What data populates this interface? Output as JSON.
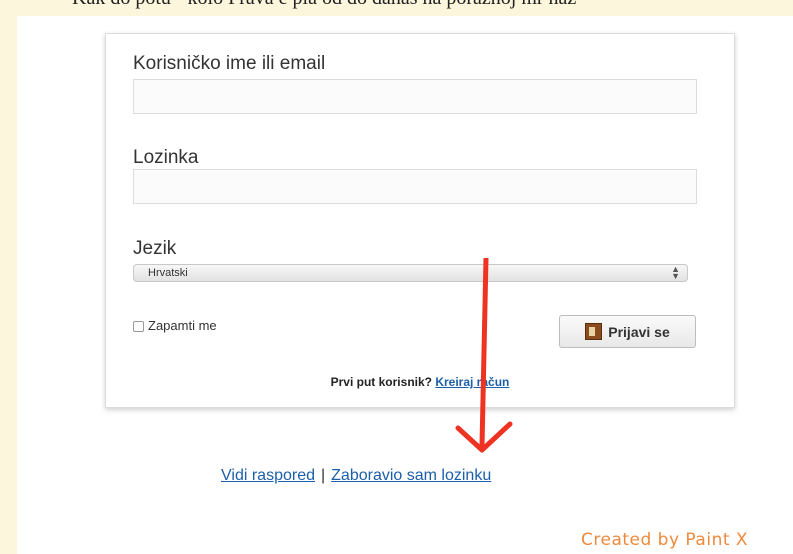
{
  "top_fragment": "Kak do potu - kolo Prava e pla od do danas na poraznoj mr naz",
  "form": {
    "username_label": "Korisničko ime ili email",
    "username_value": "",
    "password_label": "Lozinka",
    "password_value": "",
    "language_label": "Jezik",
    "language_selected": "Hrvatski",
    "remember_label": "Zapamti me",
    "remember_checked": false,
    "login_button": "Prijavi se",
    "first_time_text": "Prvi put korisnik?",
    "create_account_link": "Kreiraj račun"
  },
  "links": {
    "schedule": "Vidi raspored",
    "separator": "|",
    "forgot_password": "Zaboravio sam lozinku"
  },
  "annotation": {
    "type": "red-arrow",
    "color": "#ee3322",
    "direction": "down",
    "points_to": "Zaboravio sam lozinku"
  },
  "watermark": "Created by Paint X",
  "colors": {
    "link": "#1c5fa8",
    "watermark": "#ef8a3c",
    "frame": "#fbf6dc"
  }
}
